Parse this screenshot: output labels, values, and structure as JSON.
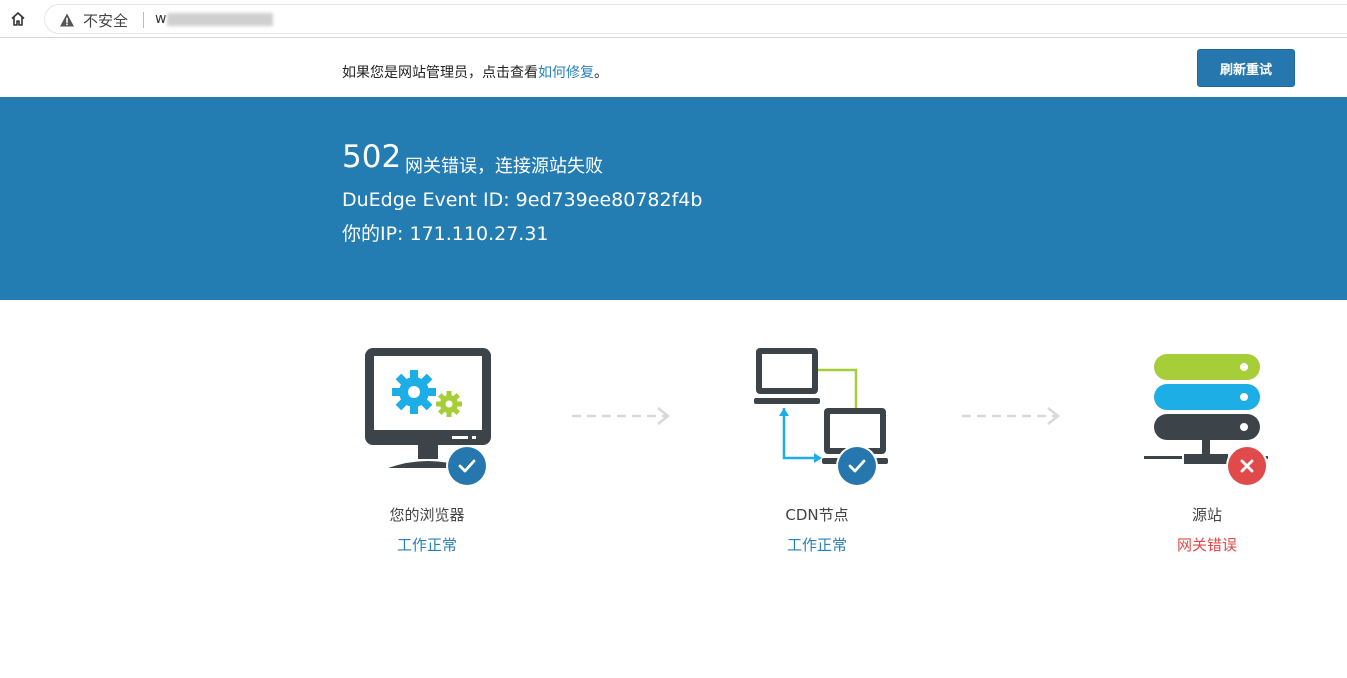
{
  "browser": {
    "security_label": "不安全",
    "url_prefix": "w"
  },
  "notice": {
    "text_before": "如果您是网站管理员，点击查看",
    "link_text": "如何修复",
    "text_after": "。"
  },
  "toolbar": {
    "refresh_label": "刷新重试"
  },
  "error": {
    "code": "502",
    "message": "网关错误，连接源站失败",
    "event_id": "DuEdge Event ID: 9ed739ee80782f4b",
    "ip": "你的IP: 171.110.27.31"
  },
  "nodes": [
    {
      "name": "您的浏览器",
      "status": "工作正常",
      "state": "ok"
    },
    {
      "name": "CDN节点",
      "status": "工作正常",
      "state": "ok"
    },
    {
      "name": "源站",
      "status": "网关错误",
      "state": "error"
    }
  ],
  "colors": {
    "brand_blue": "#237db3",
    "accent_green": "#a6ce39",
    "accent_cyan": "#1eaee6",
    "dark_gray": "#3d4449",
    "error_red": "#e04a4a"
  }
}
